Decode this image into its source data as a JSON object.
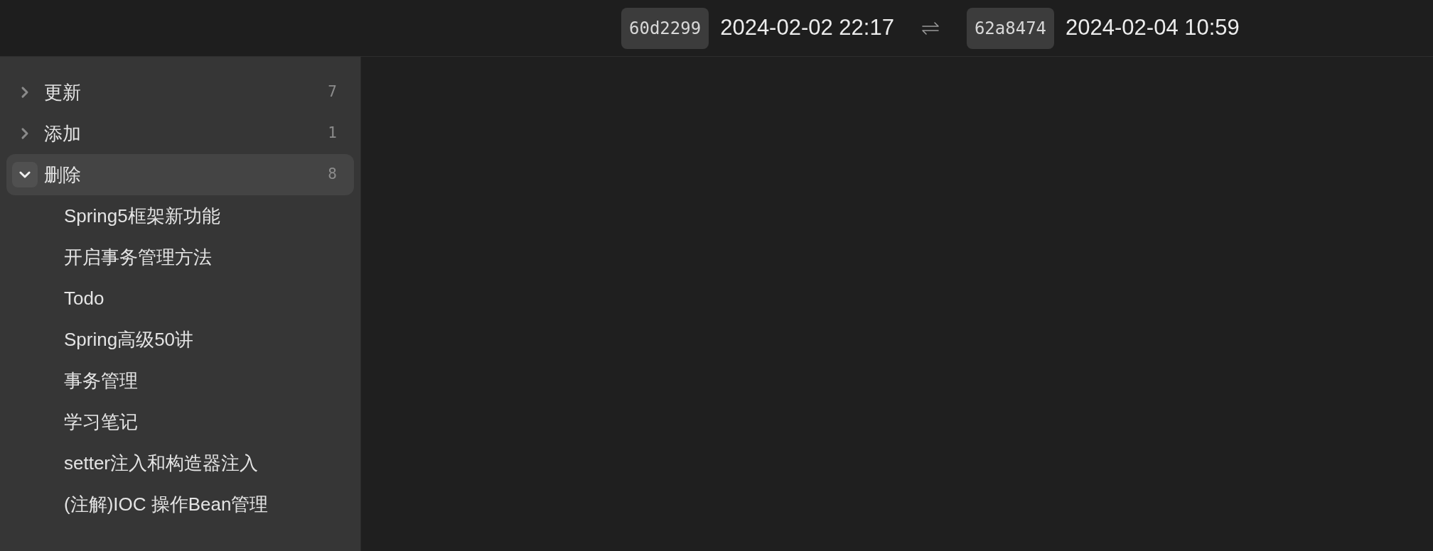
{
  "compare": {
    "from": {
      "hash": "60d2299",
      "date": "2024-02-02 22:17"
    },
    "to": {
      "hash": "62a8474",
      "date": "2024-02-04 10:59"
    }
  },
  "sidebar": {
    "groups": [
      {
        "label": "更新",
        "count": "7",
        "expanded": false,
        "selected": false
      },
      {
        "label": "添加",
        "count": "1",
        "expanded": false,
        "selected": false
      },
      {
        "label": "删除",
        "count": "8",
        "expanded": true,
        "selected": true,
        "children": [
          {
            "label": "Spring5框架新功能"
          },
          {
            "label": "开启事务管理方法"
          },
          {
            "label": "Todo"
          },
          {
            "label": "Spring高级50讲"
          },
          {
            "label": "事务管理"
          },
          {
            "label": "学习笔记"
          },
          {
            "label": "setter注入和构造器注入"
          },
          {
            "label": "(注解)IOC 操作Bean管理"
          }
        ]
      }
    ]
  }
}
